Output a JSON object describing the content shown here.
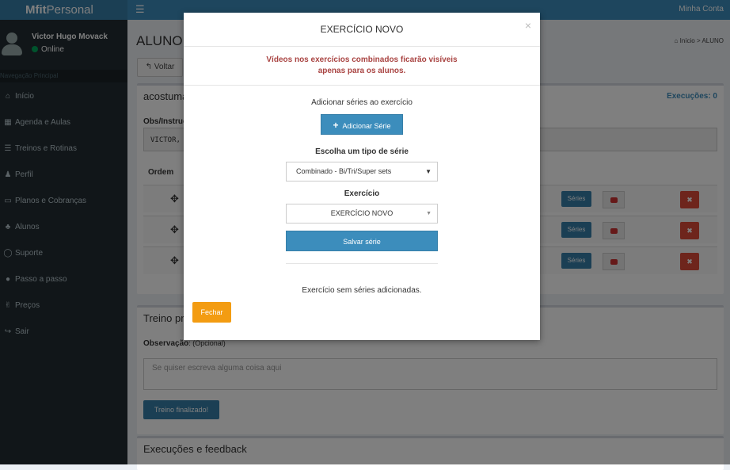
{
  "header": {
    "logo_bold": "Mfit",
    "logo_light": "Personal",
    "menu_icon": "☰",
    "account_label": "Minha Conta"
  },
  "sidebar": {
    "user_name": "Victor Hugo Movack",
    "user_status": "Online",
    "nav_header": "Navegação Principal",
    "items": [
      {
        "label": "Início",
        "icon": "⌂",
        "icon_name": "dashboard-icon"
      },
      {
        "label": "Agenda e Aulas",
        "icon": "▦",
        "icon_name": "calendar-icon"
      },
      {
        "label": "Treinos e Rotinas",
        "icon": "☰",
        "icon_name": "list-icon"
      },
      {
        "label": "Perfil",
        "icon": "♟",
        "icon_name": "user-icon"
      },
      {
        "label": "Planos e Cobranças",
        "icon": "▭",
        "icon_name": "money-icon"
      },
      {
        "label": "Alunos",
        "icon": "♣",
        "icon_name": "users-icon"
      },
      {
        "label": "Suporte",
        "icon": "◯",
        "icon_name": "chat-icon"
      },
      {
        "label": "Passo a passo",
        "icon": "●",
        "icon_name": "help-icon"
      },
      {
        "label": "Preços",
        "icon": "✌",
        "icon_name": "hand-icon"
      },
      {
        "label": "Sair",
        "icon": "↪",
        "icon_name": "logout-icon"
      }
    ]
  },
  "content": {
    "page_title": "ALUNO",
    "breadcrumb": {
      "home": "Início",
      "sep": ">",
      "current": "ALUNO"
    },
    "back_button": "Voltar",
    "box1": {
      "title": "acostuma",
      "executions": "Execuções: 0",
      "obs_label": "Obs/Instruç",
      "obs_value": "VICTOR,",
      "col_ordem": "Ordem",
      "rows": [
        {
          "series_label": "Séries",
          "delete_label": "✖"
        },
        {
          "series_label": "Séries",
          "delete_label": "✖"
        },
        {
          "series_label": "Séries",
          "delete_label": "✖"
        }
      ]
    },
    "box2": {
      "title": "Treino pr",
      "obs_label": "Observação",
      "obs_optional": ": (Opcional)",
      "placeholder": "Se quiser escreva alguma coisa aqui",
      "finish_button": "Treino finalizado!"
    },
    "box3": {
      "title": "Execuções e feedback"
    }
  },
  "modal": {
    "title": "EXERCÍCIO NOVO",
    "close": "×",
    "warning_line1": "Vídeos nos exercícios combinados ficarão visíveis",
    "warning_line2": "apenas para os alunos.",
    "add_series_label": "Adicionar séries ao exercício",
    "add_series_button": "Adicionar Série",
    "series_type_label": "Escolha um tipo de série",
    "series_type_value": "Combinado - Bi/Tri/Super sets",
    "exercise_label": "Exercício",
    "exercise_value": "EXERCÍCIO NOVO",
    "save_button": "Salvar série",
    "empty_message": "Exercício sem séries adicionadas.",
    "close_button": "Fechar"
  },
  "colors": {
    "brand": "#3c8dbc",
    "sidebar": "#222d32",
    "warning_text": "#a94442",
    "close_button": "#f39c12",
    "danger": "#dd4b39"
  }
}
